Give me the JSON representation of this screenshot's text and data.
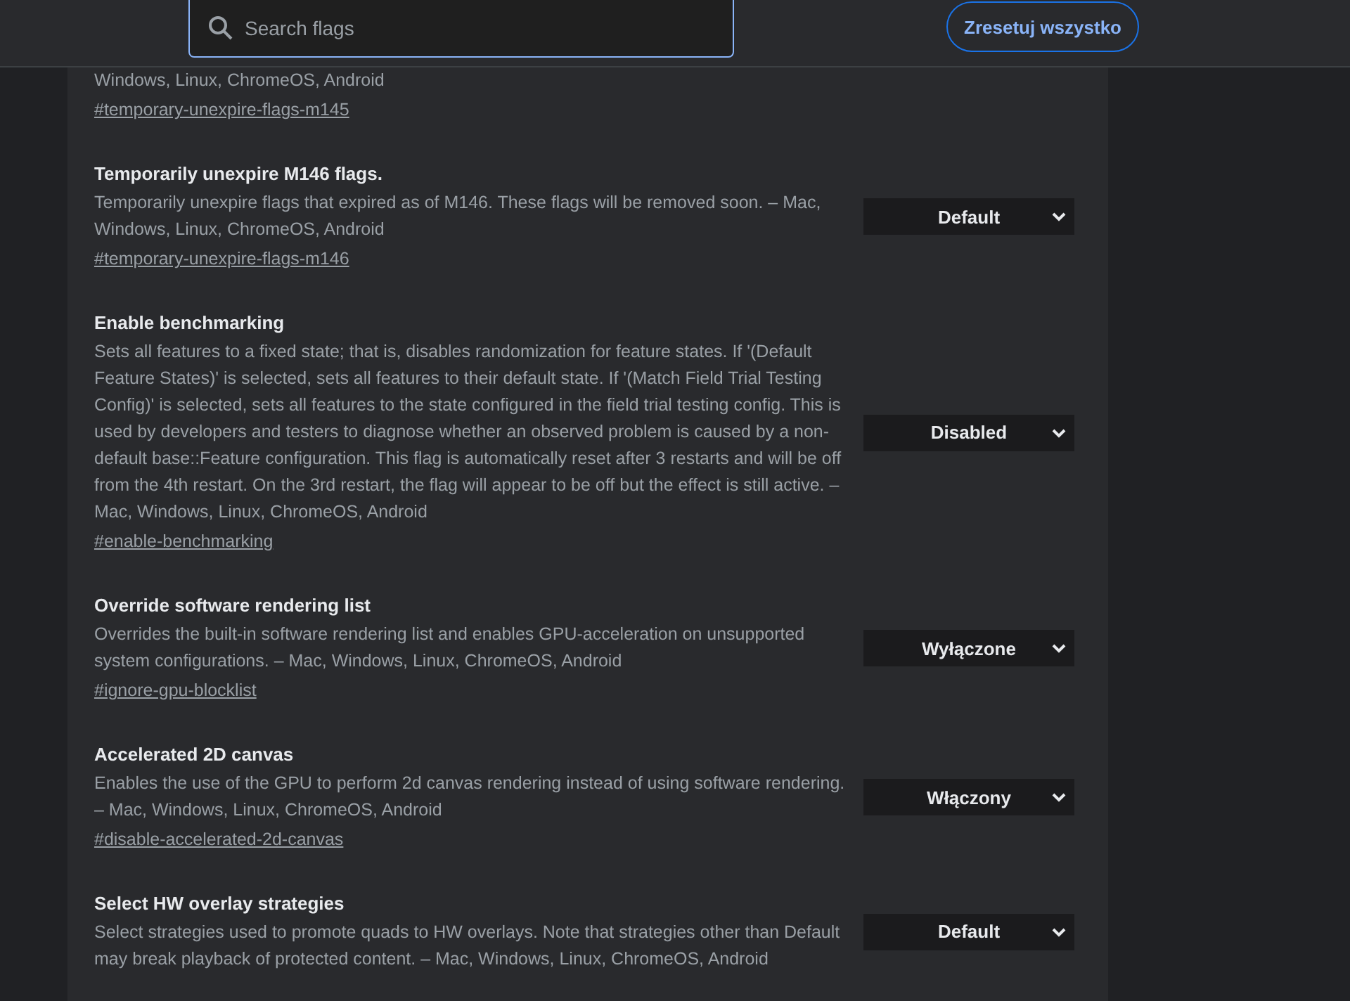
{
  "search": {
    "placeholder": "Search flags"
  },
  "reset_button": "Zresetuj wszystko",
  "flags": [
    {
      "description": "Windows, Linux, ChromeOS, Android",
      "link": "#temporary-unexpire-flags-m145"
    },
    {
      "title": "Temporarily unexpire M146 flags.",
      "description": "Temporarily unexpire flags that expired as of M146. These flags will be removed soon. – Mac, Windows, Linux, ChromeOS, Android",
      "link": "#temporary-unexpire-flags-m146",
      "value": "Default"
    },
    {
      "title": "Enable benchmarking",
      "description": "Sets all features to a fixed state; that is, disables randomization for feature states. If '(Default Feature States)' is selected, sets all features to their default state. If '(Match Field Trial Testing Config)' is selected, sets all features to the state configured in the field trial testing config. This is used by developers and testers to diagnose whether an observed problem is caused by a non-default base::Feature configuration. This flag is automatically reset after 3 restarts and will be off from the 4th restart. On the 3rd restart, the flag will appear to be off but the effect is still active. – Mac, Windows, Linux, ChromeOS, Android",
      "link": "#enable-benchmarking",
      "value": "Disabled"
    },
    {
      "title": "Override software rendering list",
      "description": "Overrides the built-in software rendering list and enables GPU-acceleration on unsupported system configurations. – Mac, Windows, Linux, ChromeOS, Android",
      "link": "#ignore-gpu-blocklist",
      "value": "Wyłączone"
    },
    {
      "title": "Accelerated 2D canvas",
      "description": "Enables the use of the GPU to perform 2d canvas rendering instead of using software rendering. – Mac, Windows, Linux, ChromeOS, Android",
      "link": "#disable-accelerated-2d-canvas",
      "value": "Włączony"
    },
    {
      "title": "Select HW overlay strategies",
      "description": "Select strategies used to promote quads to HW overlays. Note that strategies other than Default may break playback of protected content. – Mac, Windows, Linux, ChromeOS, Android",
      "value": "Default"
    }
  ]
}
